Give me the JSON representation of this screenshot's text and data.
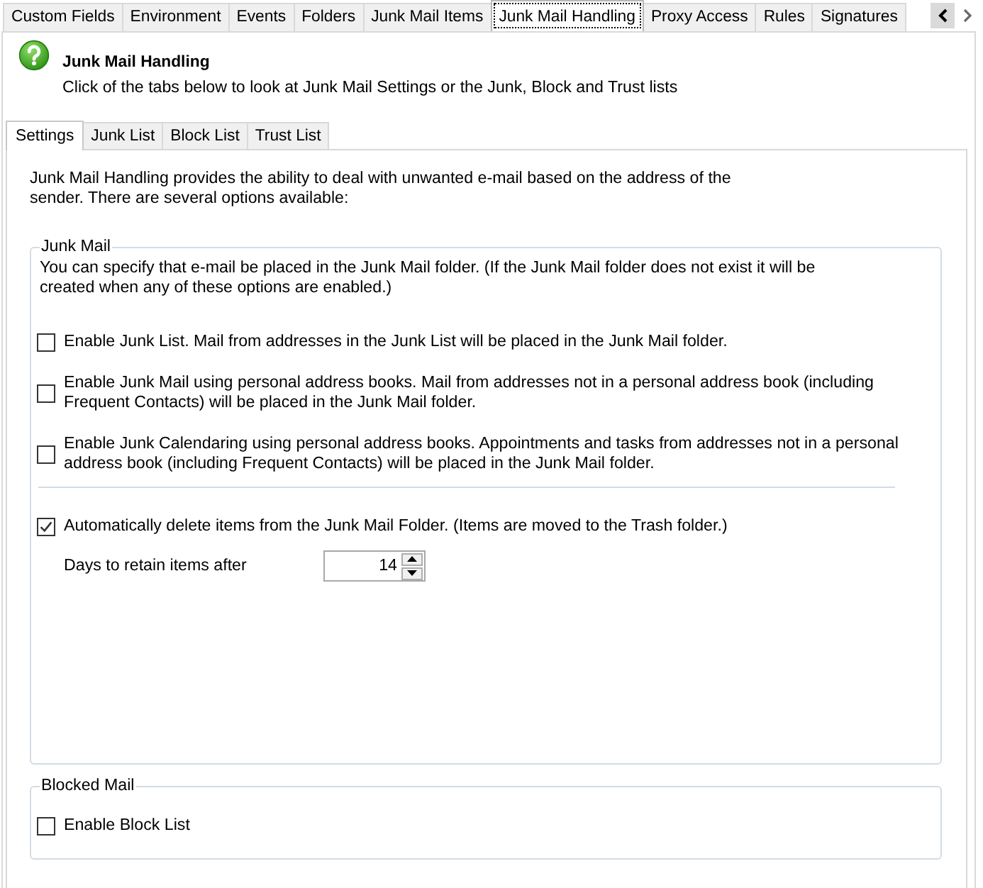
{
  "top_tabs": [
    {
      "label": "Custom Fields",
      "selected": false
    },
    {
      "label": "Environment",
      "selected": false
    },
    {
      "label": "Events",
      "selected": false
    },
    {
      "label": "Folders",
      "selected": false
    },
    {
      "label": "Junk Mail Items",
      "selected": false
    },
    {
      "label": "Junk Mail Handling",
      "selected": true
    },
    {
      "label": "Proxy Access",
      "selected": false
    },
    {
      "label": "Rules",
      "selected": false
    },
    {
      "label": "Signatures",
      "selected": false
    }
  ],
  "header": {
    "title": "Junk Mail Handling",
    "subtitle": "Click of the tabs below to look at Junk Mail Settings or the Junk, Block and Trust lists"
  },
  "sub_tabs": [
    {
      "label": "Settings",
      "selected": true
    },
    {
      "label": "Junk List",
      "selected": false
    },
    {
      "label": "Block List",
      "selected": false
    },
    {
      "label": "Trust List",
      "selected": false
    }
  ],
  "intro": "Junk Mail Handling provides the ability to deal with unwanted e-mail based on the address of the sender. There are several options available:",
  "groups": [
    {
      "title": "Junk Mail",
      "description": "You can specify that e-mail be placed in the Junk Mail folder. (If the Junk Mail folder does not exist it will be created when any of these options are enabled.)",
      "items": [
        {
          "kind": "checkbox",
          "label": "Enable Junk List. Mail from addresses in the Junk List will be placed in the Junk Mail folder.",
          "checked": false
        },
        {
          "kind": "checkbox",
          "label": "Enable Junk Mail using personal address books. Mail from addresses not in a personal address book (including Frequent Contacts) will be placed in the Junk Mail folder.",
          "checked": false
        },
        {
          "kind": "checkbox",
          "label": "Enable Junk Calendaring using personal address books. Appointments and tasks from addresses not in a personal address book (including Frequent Contacts) will be placed in the Junk Mail folder.",
          "checked": false
        },
        {
          "kind": "separator"
        },
        {
          "kind": "checkbox",
          "label": "Automatically delete items from the Junk Mail Folder. (Items are moved to the Trash folder.)",
          "checked": true
        },
        {
          "kind": "spinner",
          "label": "Days to retain items after",
          "value": "14"
        }
      ]
    },
    {
      "title": "Blocked Mail",
      "items": [
        {
          "kind": "checkbox",
          "label": "Enable Block List",
          "checked": false
        }
      ]
    }
  ]
}
